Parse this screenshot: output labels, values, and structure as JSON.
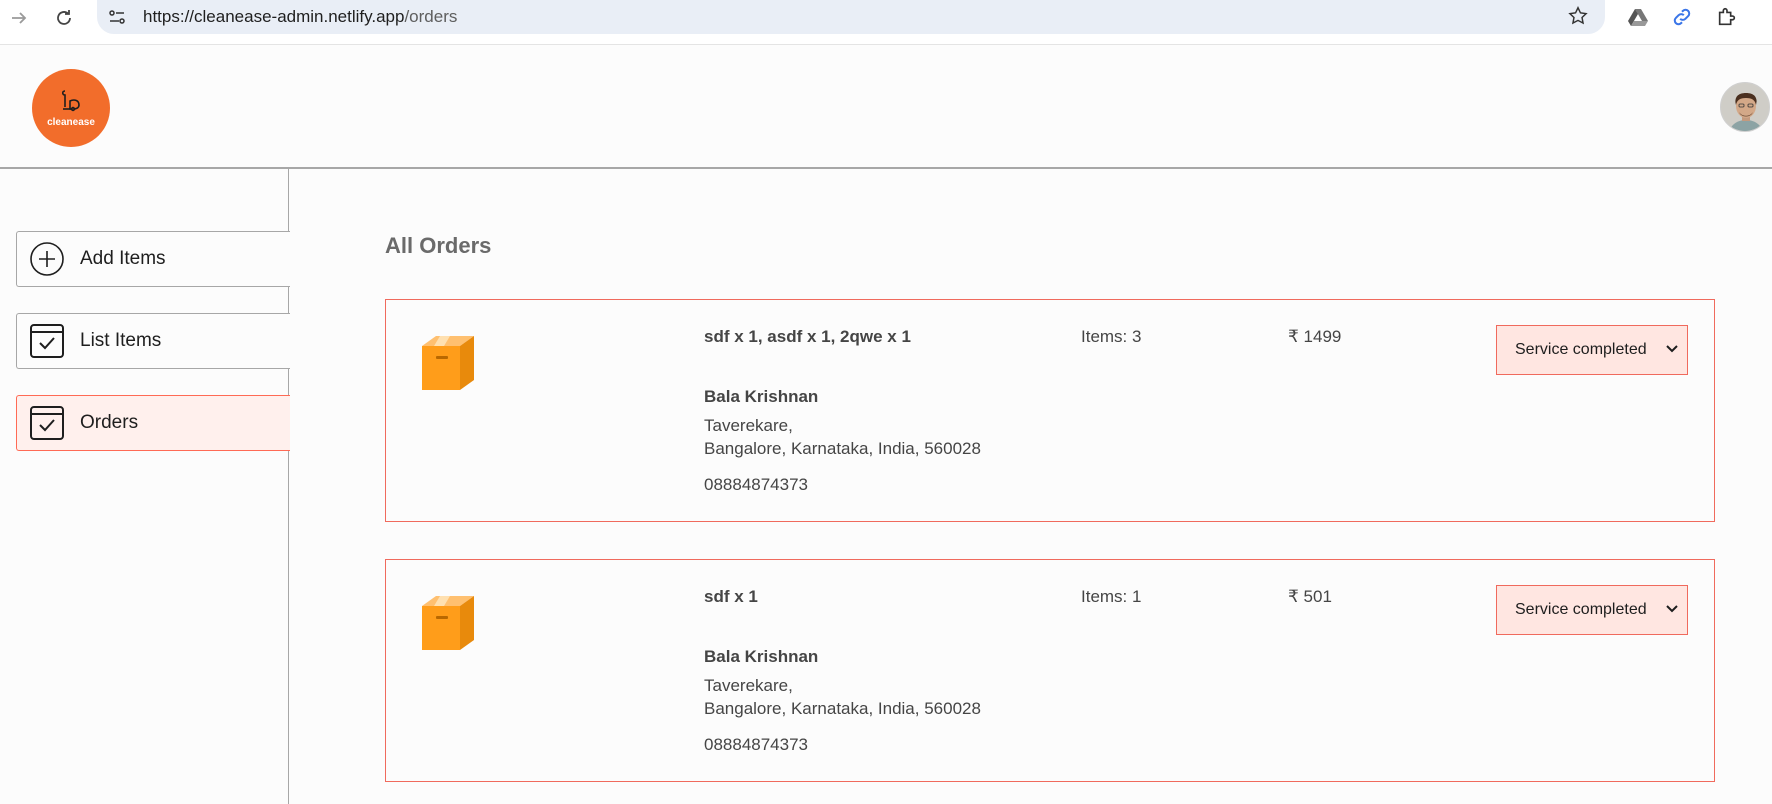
{
  "browser": {
    "url_host": "https://cleanease-admin.netlify.app",
    "url_path": "/orders"
  },
  "header": {
    "logo_text": "cleanease"
  },
  "sidebar": {
    "items": [
      {
        "label": "Add Items",
        "icon": "plus-circle-icon"
      },
      {
        "label": "List Items",
        "icon": "checkbox-icon"
      },
      {
        "label": "Orders",
        "icon": "checkbox-icon",
        "active": true
      }
    ]
  },
  "main": {
    "title": "All Orders",
    "orders": [
      {
        "items": "sdf x 1, asdf x 1, 2qwe x 1",
        "customer": "Bala Krishnan",
        "address_line1": "Taverekare,",
        "address_line2": "Bangalore, Karnataka, India, 560028",
        "phone": "08884874373",
        "count": "Items: 3",
        "amount": "₹ 1499",
        "status": "Service completed"
      },
      {
        "items": "sdf x 1",
        "customer": "Bala Krishnan",
        "address_line1": "Taverekare,",
        "address_line2": "Bangalore, Karnataka, India, 560028",
        "phone": "08884874373",
        "count": "Items: 1",
        "amount": "₹ 501",
        "status": "Service completed"
      }
    ]
  },
  "colors": {
    "accent": "#f26d2b",
    "card_border": "#f06a5d",
    "active_bg": "#fff0ed",
    "status_bg": "#ffe6e1"
  }
}
